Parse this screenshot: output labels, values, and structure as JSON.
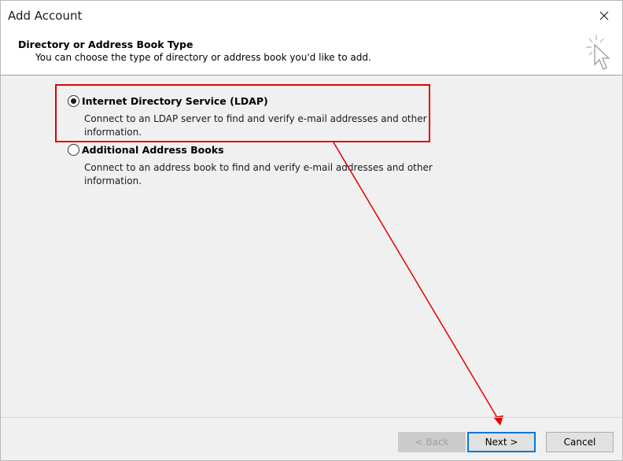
{
  "window": {
    "title": "Add Account"
  },
  "header": {
    "title": "Directory or Address Book Type",
    "subtitle": "You can choose the type of directory or address book you'd like to add."
  },
  "options": [
    {
      "label": "Internet Directory Service (LDAP)",
      "description": "Connect to an LDAP server to find and verify e-mail addresses and other information.",
      "selected": true
    },
    {
      "label": "Additional Address Books",
      "description": "Connect to an address book to find and verify e-mail addresses and other information.",
      "selected": false
    }
  ],
  "buttons": {
    "back": "< Back",
    "next": "Next >",
    "cancel": "Cancel"
  },
  "icons": {
    "close": "close-icon",
    "wizard": "sparkle-cursor-icon"
  },
  "colors": {
    "annotation": "#e30000",
    "accent": "#0078d7"
  }
}
